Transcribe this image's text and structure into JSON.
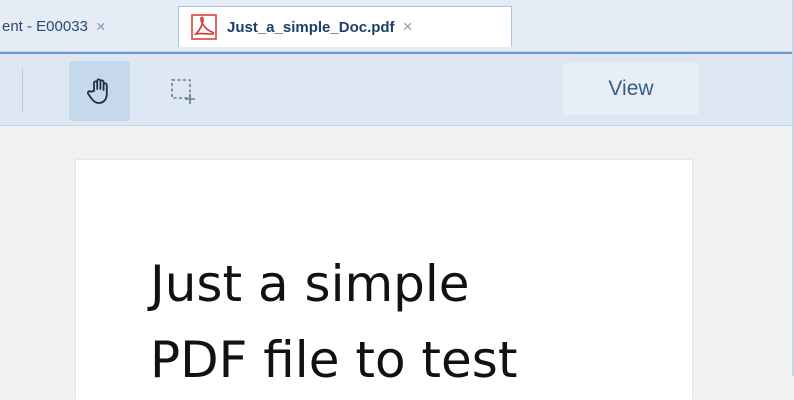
{
  "tabs": [
    {
      "label": "ent - E00033",
      "active": false
    },
    {
      "label": "Just_a_simple_Doc.pdf",
      "active": true
    }
  ],
  "tab_close_glyph": "×",
  "toolbar": {
    "hand_tool_icon": "hand-pan-icon",
    "select_tool_icon": "marquee-select-icon",
    "view_label": "View"
  },
  "document": {
    "text": "Just a simple\nPDF file to test"
  },
  "colors": {
    "tabbar_bg": "#e5ecf6",
    "accent_line": "#6e99cf",
    "toolbar_bg": "#dde8f4",
    "hand_active_bg": "#c6d8ec",
    "pdf_icon_red": "#d9342b"
  }
}
